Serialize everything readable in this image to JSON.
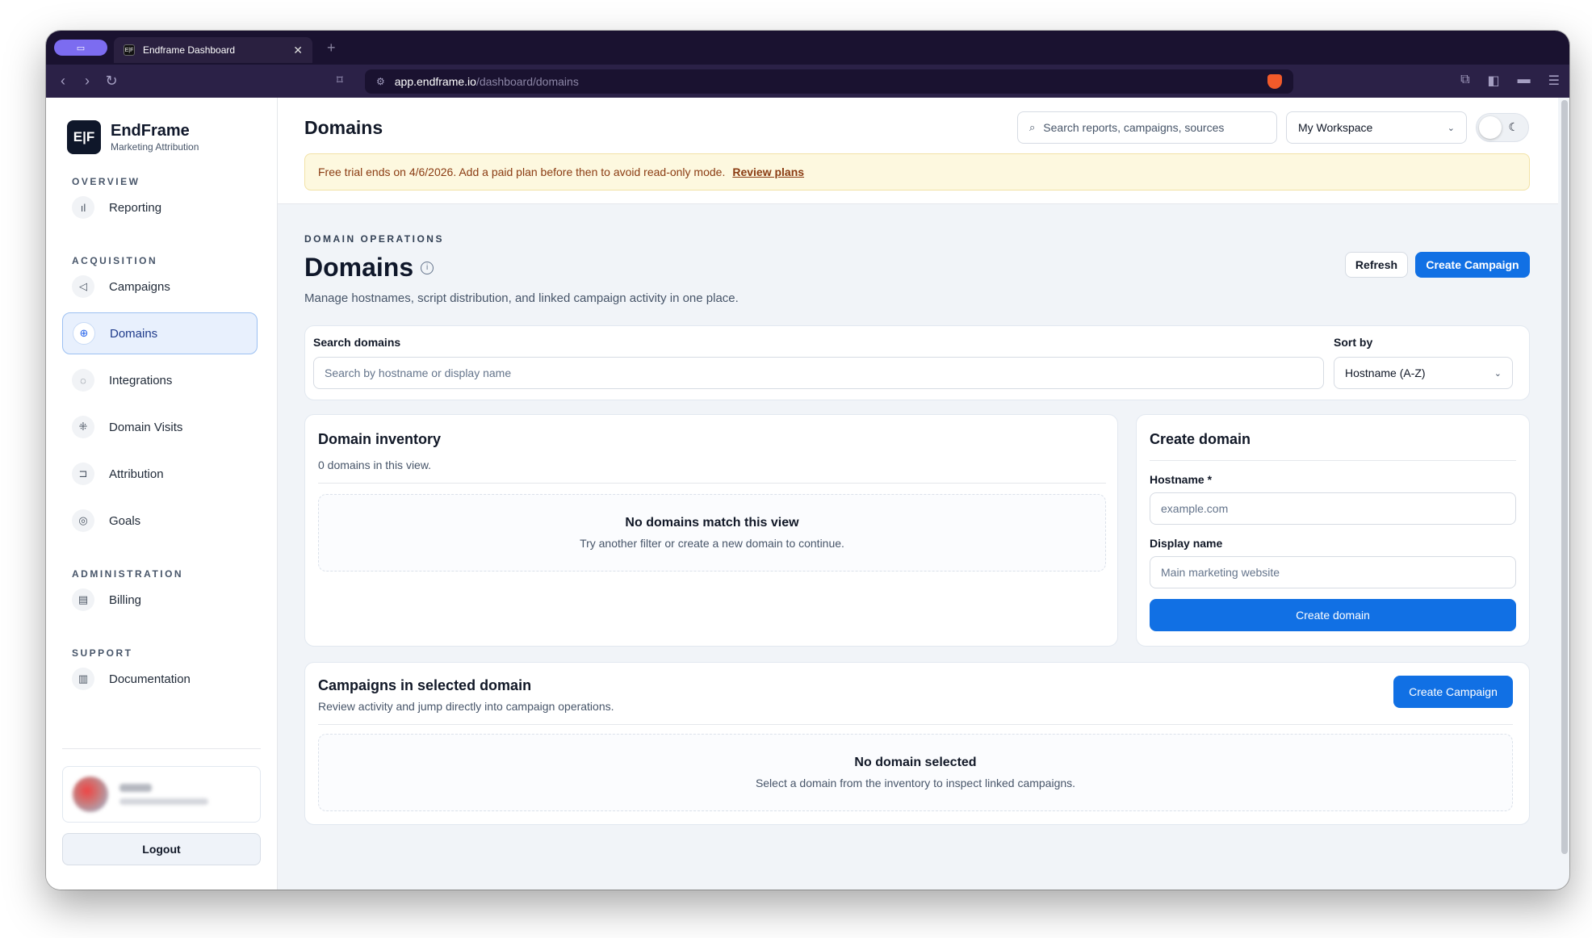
{
  "browser": {
    "tab_title": "Endframe Dashboard",
    "tab_favicon": "E|F",
    "url_host": "app.endframe.io",
    "url_path": "/dashboard/domains"
  },
  "sidebar": {
    "brand_logo": "E|F",
    "brand_name": "EndFrame",
    "brand_sub": "Marketing Attribution",
    "sections": {
      "overview": "OVERVIEW",
      "acquisition": "ACQUISITION",
      "administration": "ADMINISTRATION",
      "support": "SUPPORT"
    },
    "items": {
      "reporting": "Reporting",
      "campaigns": "Campaigns",
      "domains": "Domains",
      "integrations": "Integrations",
      "domain_visits": "Domain Visits",
      "attribution": "Attribution",
      "goals": "Goals",
      "billing": "Billing",
      "documentation": "Documentation"
    },
    "logout_label": "Logout"
  },
  "header": {
    "title": "Domains",
    "search_placeholder": "Search reports, campaigns, sources",
    "workspace": "My Workspace"
  },
  "banner": {
    "text": "Free trial ends on 4/6/2026. Add a paid plan before then to avoid read-only mode.",
    "link": "Review plans"
  },
  "page": {
    "eyebrow": "DOMAIN OPERATIONS",
    "title": "Domains",
    "subtitle": "Manage hostnames, script distribution, and linked campaign activity in one place.",
    "refresh_label": "Refresh",
    "create_campaign_label": "Create Campaign"
  },
  "filters": {
    "search_label": "Search domains",
    "search_placeholder": "Search by hostname or display name",
    "sort_label": "Sort by",
    "sort_value": "Hostname (A-Z)"
  },
  "inventory": {
    "title": "Domain inventory",
    "count_text": "0 domains in this view.",
    "empty_title": "No domains match this view",
    "empty_sub": "Try another filter or create a new domain to continue."
  },
  "create_domain": {
    "title": "Create domain",
    "hostname_label": "Hostname *",
    "hostname_placeholder": "example.com",
    "display_label": "Display name",
    "display_placeholder": "Main marketing website",
    "submit_label": "Create domain"
  },
  "campaigns_panel": {
    "title": "Campaigns in selected domain",
    "subtitle": "Review activity and jump directly into campaign operations.",
    "button_label": "Create Campaign",
    "empty_title": "No domain selected",
    "empty_sub": "Select a domain from the inventory to inspect linked campaigns."
  },
  "colors": {
    "primary": "#1170e4",
    "chrome": "#1a1230",
    "banner_bg": "#fdf8df",
    "banner_text": "#8a3b12"
  }
}
